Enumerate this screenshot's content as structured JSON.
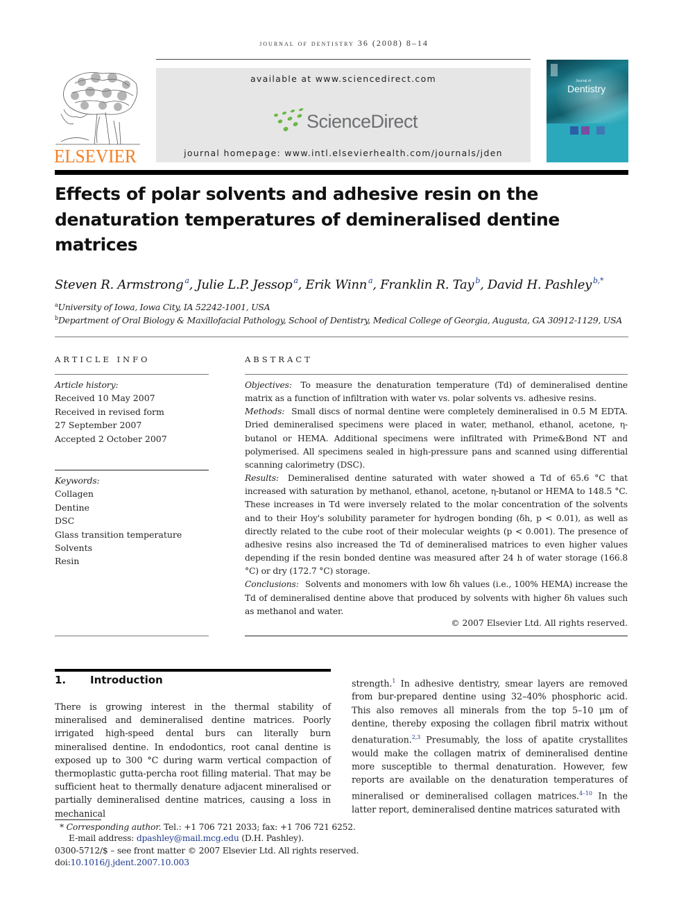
{
  "header": {
    "running_head": "journal of dentistry 36 (2008) 8–14",
    "publisher": "ELSEVIER",
    "available_at": "available at www.sciencedirect.com",
    "sciencedirect": "ScienceDirect",
    "homepage": "journal homepage: www.intl.elsevierhealth.com/journals/jden",
    "cover_title": "Dentistry",
    "cover_subtitle": "Journal of",
    "brand_color": "#f47e20",
    "sd_green": "#6ab745"
  },
  "article": {
    "title": "Effects of polar solvents and adhesive resin on the denaturation temperatures of demineralised dentine matrices",
    "authors": [
      {
        "name": "Steven R. Armstrong",
        "sup": "a"
      },
      {
        "name": "Julie L.P. Jessop",
        "sup": "a"
      },
      {
        "name": "Erik Winn",
        "sup": "a"
      },
      {
        "name": "Franklin R. Tay",
        "sup": "b"
      },
      {
        "name": "David H. Pashley",
        "sup": "b,*"
      }
    ],
    "affiliations": [
      {
        "sup": "a",
        "text": "University of Iowa, Iowa City, IA 52242-1001, USA"
      },
      {
        "sup": "b",
        "text": "Department of Oral Biology & Maxillofacial Pathology, School of Dentistry, Medical College of Georgia, Augusta, GA 30912-1129, USA"
      }
    ]
  },
  "article_info": {
    "heading": "ARTICLE INFO",
    "history_label": "Article history:",
    "history": [
      "Received 10 May 2007",
      "Received in revised form",
      "27 September 2007",
      "Accepted 2 October 2007"
    ],
    "keywords_label": "Keywords:",
    "keywords": [
      "Collagen",
      "Dentine",
      "DSC",
      "Glass transition temperature",
      "Solvents",
      "Resin"
    ]
  },
  "abstract": {
    "heading": "ABSTRACT",
    "objectives_label": "Objectives:",
    "objectives": "To measure the denaturation temperature (Td) of demineralised dentine matrix as a function of infiltration with water vs. polar solvents vs. adhesive resins.",
    "methods_label": "Methods:",
    "methods": "Small discs of normal dentine were completely demineralised in 0.5 M EDTA. Dried demineralised specimens were placed in water, methanol, ethanol, acetone, η-butanol or HEMA. Additional specimens were infiltrated with Prime&Bond NT and polymerised. All specimens sealed in high-pressure pans and scanned using differential scanning calorimetry (DSC).",
    "results_label": "Results:",
    "results": "Demineralised dentine saturated with water showed a Td of 65.6 °C that increased with saturation by methanol, ethanol, acetone, η-butanol or HEMA to 148.5 °C. These increases in Td were inversely related to the molar concentration of the solvents and to their Hoy's solubility parameter for hydrogen bonding (δh, p < 0.01), as well as directly related to the cube root of their molecular weights (p < 0.001). The presence of adhesive resins also increased the Td of demineralised matrices to even higher values depending if the resin bonded dentine was measured after 24 h of water storage (166.8 °C) or dry (172.7 °C) storage.",
    "conclusions_label": "Conclusions:",
    "conclusions": "Solvents and monomers with low δh values (i.e., 100% HEMA) increase the Td of demineralised dentine above that produced by solvents with higher δh values such as methanol and water.",
    "copyright": "© 2007 Elsevier Ltd. All rights reserved."
  },
  "introduction": {
    "number": "1.",
    "heading": "Introduction",
    "col1": "There is growing interest in the thermal stability of mineralised and demineralised dentine matrices. Poorly irrigated high-speed dental burs can literally burn mineralised dentine. In endodontics, root canal dentine is exposed up to 300 °C during warm vertical compaction of thermoplastic gutta-percha root filling material. That may be sufficient heat to thermally denature adjacent mineralised or partially demineralised dentine matrices, causing a loss in mechanical",
    "col2_parts": [
      "strength.",
      "1",
      " In adhesive dentistry, smear layers are removed from bur-prepared dentine using 32–40% phosphoric acid. This also removes all minerals from the top 5–10 μm of dentine, thereby exposing the collagen fibril matrix without denaturation.",
      "2,3",
      " Presumably, the loss of apatite crystallites would make the collagen matrix of demineralised dentine more susceptible to thermal denaturation. However, few reports are available on the denaturation temperatures of mineralised or demineralised collagen matrices.",
      "4–10",
      " In the latter report, demineralised dentine matrices saturated with"
    ]
  },
  "footnote": {
    "corresponding_mark": "*",
    "corresponding_label": "Corresponding author.",
    "contact": "Tel.: +1 706 721 2033; fax: +1 706 721 6252.",
    "email_label": "E-mail address:",
    "email": "dpashley@mail.mcg.edu",
    "email_owner": "(D.H. Pashley).",
    "front_matter": "0300-5712/$ – see front matter © 2007 Elsevier Ltd. All rights reserved.",
    "doi_label": "doi:",
    "doi": "10.1016/j.jdent.2007.10.003"
  }
}
